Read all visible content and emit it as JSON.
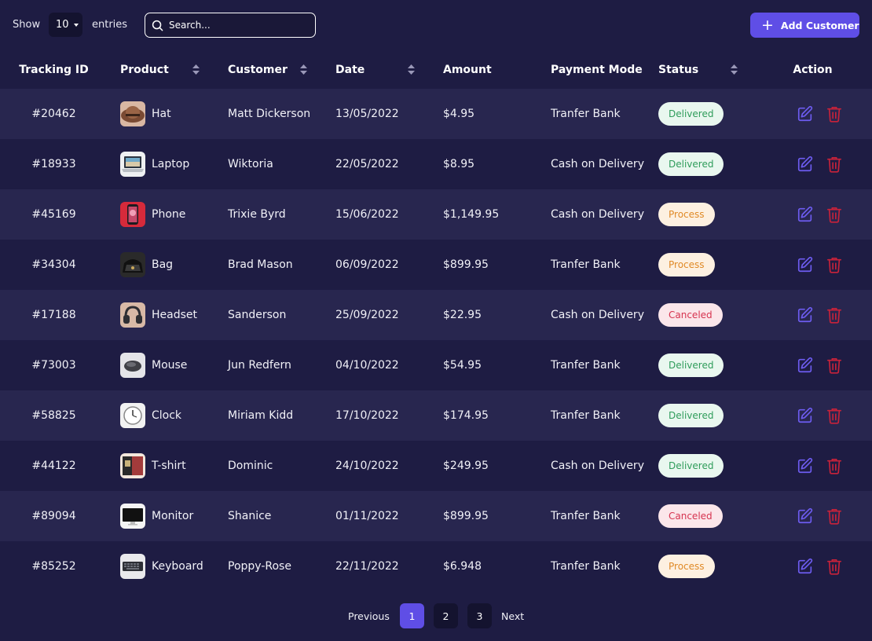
{
  "toolbar": {
    "show_label": "Show",
    "entries_value": "10",
    "entries_label": "entries",
    "search_placeholder": "Search...",
    "add_button_label": "Add Customer"
  },
  "columns": [
    "Tracking ID",
    "Product",
    "Customer",
    "Date",
    "Amount",
    "Payment Mode",
    "Status",
    "Action"
  ],
  "rows": [
    {
      "id": "#20462",
      "product": "Hat",
      "customer": "Matt Dickerson",
      "date": "13/05/2022",
      "amount": "$4.95",
      "payment": "Tranfer Bank",
      "status": "Delivered"
    },
    {
      "id": "#18933",
      "product": "Laptop",
      "customer": "Wiktoria",
      "date": "22/05/2022",
      "amount": "$8.95",
      "payment": "Cash on Delivery",
      "status": "Delivered"
    },
    {
      "id": "#45169",
      "product": "Phone",
      "customer": "Trixie Byrd",
      "date": "15/06/2022",
      "amount": "$1,149.95",
      "payment": "Cash on Delivery",
      "status": "Process"
    },
    {
      "id": "#34304",
      "product": "Bag",
      "customer": "Brad Mason",
      "date": "06/09/2022",
      "amount": "$899.95",
      "payment": "Tranfer Bank",
      "status": "Process"
    },
    {
      "id": "#17188",
      "product": "Headset",
      "customer": "Sanderson",
      "date": "25/09/2022",
      "amount": "$22.95",
      "payment": "Cash on Delivery",
      "status": "Canceled"
    },
    {
      "id": "#73003",
      "product": "Mouse",
      "customer": "Jun Redfern",
      "date": "04/10/2022",
      "amount": "$54.95",
      "payment": "Tranfer Bank",
      "status": "Delivered"
    },
    {
      "id": "#58825",
      "product": "Clock",
      "customer": "Miriam Kidd",
      "date": "17/10/2022",
      "amount": "$174.95",
      "payment": "Tranfer Bank",
      "status": "Delivered"
    },
    {
      "id": "#44122",
      "product": "T-shirt",
      "customer": "Dominic",
      "date": "24/10/2022",
      "amount": "$249.95",
      "payment": "Cash on Delivery",
      "status": "Delivered"
    },
    {
      "id": "#89094",
      "product": "Monitor",
      "customer": "Shanice",
      "date": "01/11/2022",
      "amount": "$899.95",
      "payment": "Tranfer Bank",
      "status": "Canceled"
    },
    {
      "id": "#85252",
      "product": "Keyboard",
      "customer": "Poppy-Rose",
      "date": "22/11/2022",
      "amount": "$6.948",
      "payment": "Tranfer Bank",
      "status": "Process"
    }
  ],
  "pagination": {
    "previous_label": "Previous",
    "pages": [
      "1",
      "2",
      "3"
    ],
    "active_page": "1",
    "next_label": "Next"
  },
  "colors": {
    "background": "#1e1c43",
    "row_alt": "#28264f",
    "accent": "#5f4ee6",
    "edit_icon": "#6d5cf0",
    "delete_icon": "#c8223a"
  }
}
